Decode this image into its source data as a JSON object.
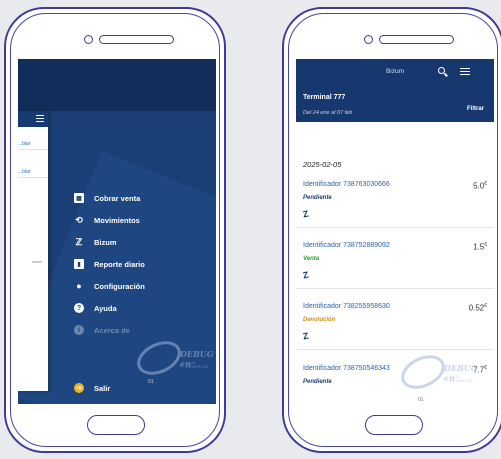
{
  "left_screen": {
    "side_panel_links": [
      "...blar",
      "...blar"
    ],
    "menu_items": [
      {
        "label": "Cobrar venta",
        "icon": "calculator-icon",
        "glyph": "▦"
      },
      {
        "label": "Movimientos",
        "icon": "history-icon",
        "glyph": "⟲"
      },
      {
        "label": "Bizum",
        "icon": "bizum-icon",
        "glyph": "ℤ"
      },
      {
        "label": "Reporte diario",
        "icon": "bar-chart-icon",
        "glyph": "▮"
      },
      {
        "label": "Configuración",
        "icon": "gear-icon",
        "glyph": "●"
      },
      {
        "label": "Ayuda",
        "icon": "help-icon",
        "glyph": "?"
      },
      {
        "label": "Acerca de",
        "icon": "info-icon",
        "glyph": "i"
      }
    ],
    "exit_item": {
      "label": "Salir",
      "icon": "exit-icon",
      "glyph": "➜"
    },
    "page_number": "01"
  },
  "watermark": {
    "brand": "DEBUG en",
    "sub": "CAJA COMERCIAL"
  },
  "right_screen": {
    "title": "Bizum",
    "terminal": "Terminal 777",
    "date_range": "Del 24 ene al 07 feb",
    "filter_label": "Filtrar",
    "date_group": "2025-02-05",
    "transactions": [
      {
        "id": "Identificador 738763030666",
        "amount": "5.0",
        "currency": "€",
        "status": "Pendiente",
        "status_color": "#1f3b7a"
      },
      {
        "id": "Identificador 738752889092",
        "amount": "1.5",
        "currency": "€",
        "status": "Venta",
        "status_color": "#2e9a3c"
      },
      {
        "id": "Identificador 738255958630",
        "amount": "0.52",
        "currency": "€",
        "status": "Devolución",
        "status_color": "#c9901a"
      },
      {
        "id": "Identificador 738750546343",
        "amount": "7.7",
        "currency": "€",
        "status": "Pendiente",
        "status_color": "#1f3b7a"
      }
    ],
    "bizum_glyph": "Z",
    "page_number": "01"
  }
}
